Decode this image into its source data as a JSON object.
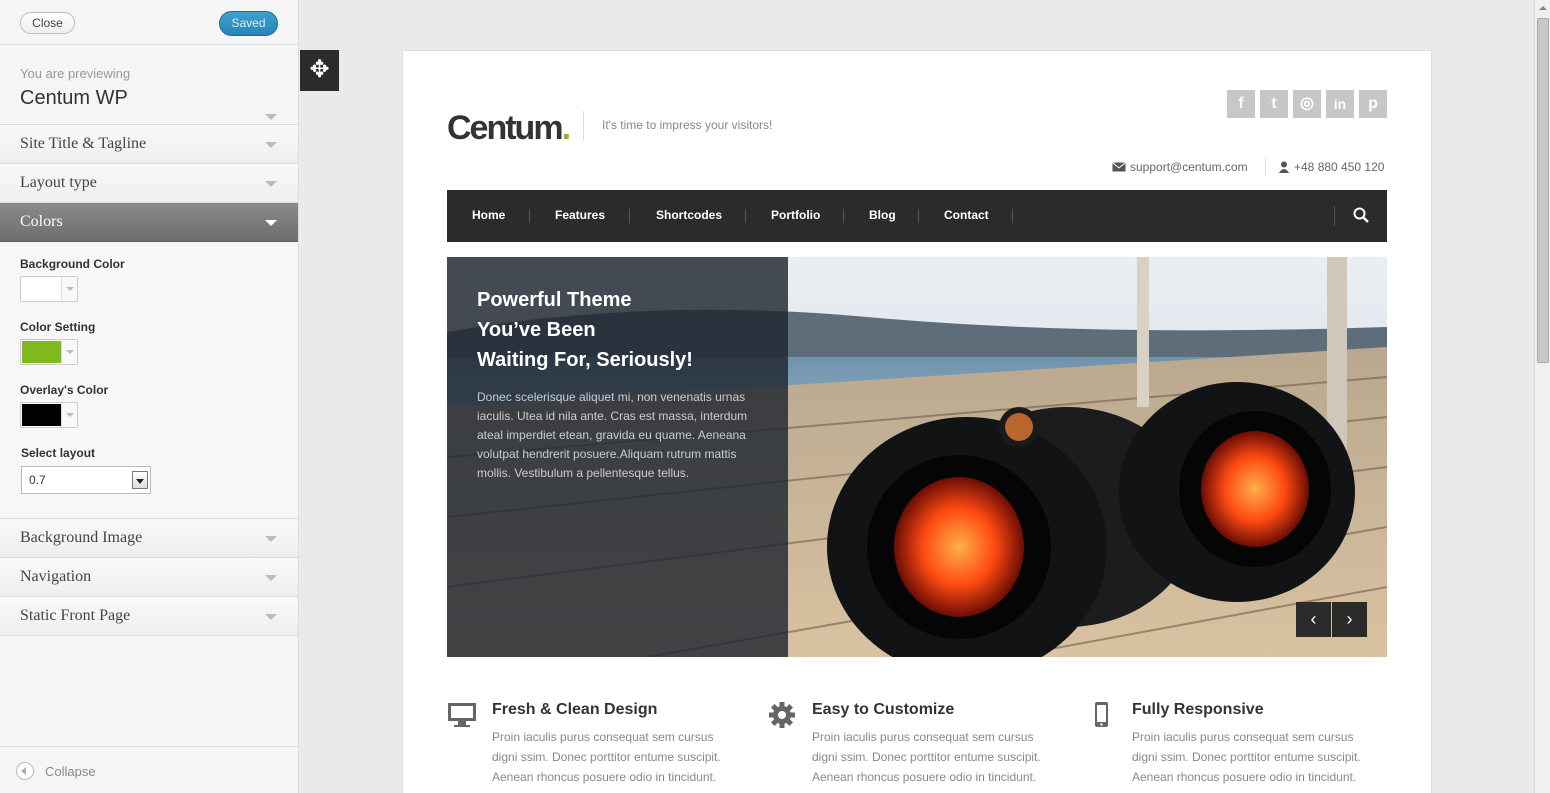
{
  "sidebar": {
    "close_label": "Close",
    "saved_label": "Saved",
    "previewing_label": "You are previewing",
    "theme_name": "Centum WP",
    "sections": {
      "site_title": "Site Title & Tagline",
      "layout_type": "Layout type",
      "colors": "Colors",
      "background_image": "Background Image",
      "navigation": "Navigation",
      "static_front_page": "Static Front Page"
    },
    "colors_panel": {
      "background_color_label": "Background Color",
      "background_color_value": "#ffffff",
      "color_setting_label": "Color Setting",
      "color_setting_value": "#80b91e",
      "overlay_color_label": "Overlay's Color",
      "overlay_color_value": "#000000",
      "select_layout_label": "Select layout",
      "select_layout_value": "0.7"
    },
    "collapse_label": "Collapse"
  },
  "site": {
    "logo_text": "Centum",
    "logo_dot": ".",
    "tagline": "It's time to impress your visitors!",
    "social_icons": [
      "facebook-icon",
      "twitter-icon",
      "dribbble-icon",
      "linkedin-icon",
      "pinterest-icon"
    ],
    "social_glyphs": [
      "f",
      "t",
      "◎",
      "in",
      "p"
    ],
    "email": "support@centum.com",
    "phone": "+48 880 450 120",
    "nav": [
      "Home",
      "Features",
      "Shortcodes",
      "Portfolio",
      "Blog",
      "Contact"
    ],
    "slide": {
      "title_line1": "Powerful Theme",
      "title_line2": "You’ve Been",
      "title_line3": "Waiting For, Seriously!",
      "text": "Donec scelerisque aliquet mi, non venenatis urnas iaculis. Utea id nila ante. Cras est massa, interdum ateal imperdiet etean, gravida eu quame. Aeneana volutpat hendrerit posuere.Aliquam rutrum mattis mollis. Vestibulum a pellentesque tellus.",
      "prev_glyph": "‹",
      "next_glyph": "›"
    },
    "features": [
      {
        "title": "Fresh & Clean Design",
        "text": "Proin iaculis purus consequat sem cursus digni ssim. Donec porttitor entume suscipit. Aenean rhoncus posuere odio in tincidunt."
      },
      {
        "title": "Easy to Customize",
        "text": "Proin iaculis purus consequat sem cursus digni ssim. Donec porttitor entume suscipit. Aenean rhoncus posuere odio in tincidunt."
      },
      {
        "title": "Fully Responsive",
        "text": "Proin iaculis purus consequat sem cursus digni ssim. Donec porttitor entume suscipit. Aenean rhoncus posuere odio in tincidunt."
      }
    ],
    "accent_color": "#8bb92d"
  },
  "drag_glyph": "✥"
}
